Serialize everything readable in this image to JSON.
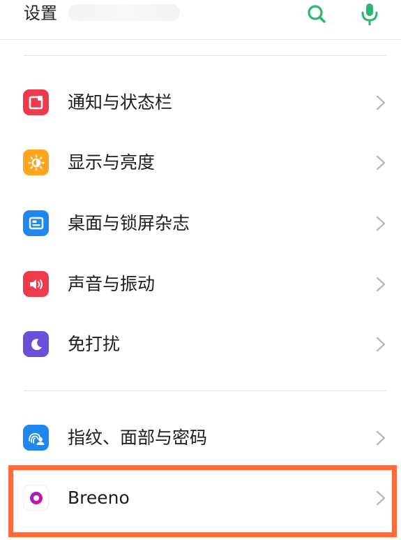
{
  "header": {
    "title": "设置",
    "search_icon": "search-icon",
    "mic_icon": "mic-icon"
  },
  "colors": {
    "accent": "#2bb673",
    "highlight": "#ff6a3a",
    "notification": "#ee3b4b",
    "display": "#ffa41e",
    "wallpaper": "#1f88f0",
    "sound": "#ee3b4b",
    "dnd": "#6a4fd8",
    "biometrics": "#1f88f0",
    "breeno": "#d1119a"
  },
  "settings": {
    "items": [
      {
        "label": "通知与状态栏",
        "icon": "notification-bar-icon"
      },
      {
        "label": "显示与亮度",
        "icon": "brightness-icon"
      },
      {
        "label": "桌面与锁屏杂志",
        "icon": "wallpaper-icon"
      },
      {
        "label": "声音与振动",
        "icon": "speaker-icon"
      },
      {
        "label": "免打扰",
        "icon": "moon-icon"
      },
      {
        "label": "指纹、面部与密码",
        "icon": "fingerprint-face-icon"
      },
      {
        "label": "Breeno",
        "icon": "breeno-icon"
      }
    ]
  }
}
